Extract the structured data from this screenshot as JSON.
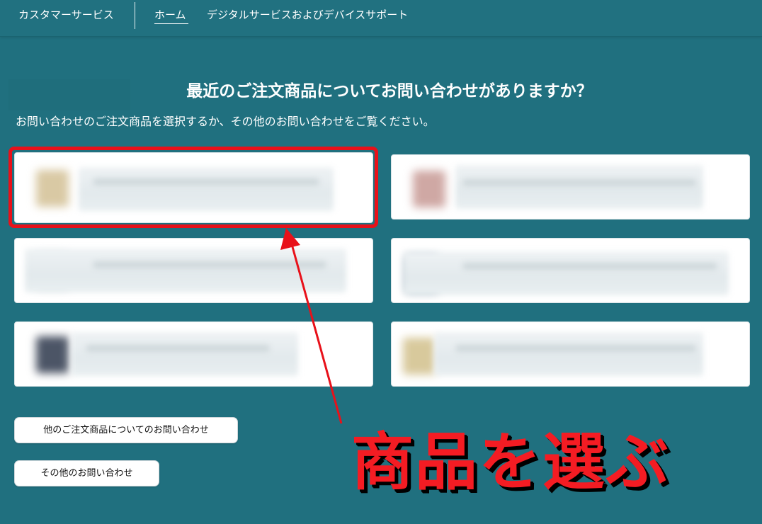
{
  "nav": {
    "brand": "カスタマーサービス",
    "home": "ホーム",
    "digital_support": "デジタルサービスおよびデバイスサポート"
  },
  "main": {
    "title": "最近のご注文商品についてお問い合わせがありますか？",
    "subtitle": "お問い合わせのご注文商品を選択するか、その他のお問い合わせをご覧ください。"
  },
  "buttons": {
    "other_orders": "他のご注文商品についてのお問い合わせ",
    "other_inquiries": "その他のお問い合わせ"
  },
  "annotation": {
    "label": "商品を選ぶ",
    "color": "#f41c23"
  },
  "colors": {
    "background": "#20707f",
    "highlight": "#e8111a"
  }
}
